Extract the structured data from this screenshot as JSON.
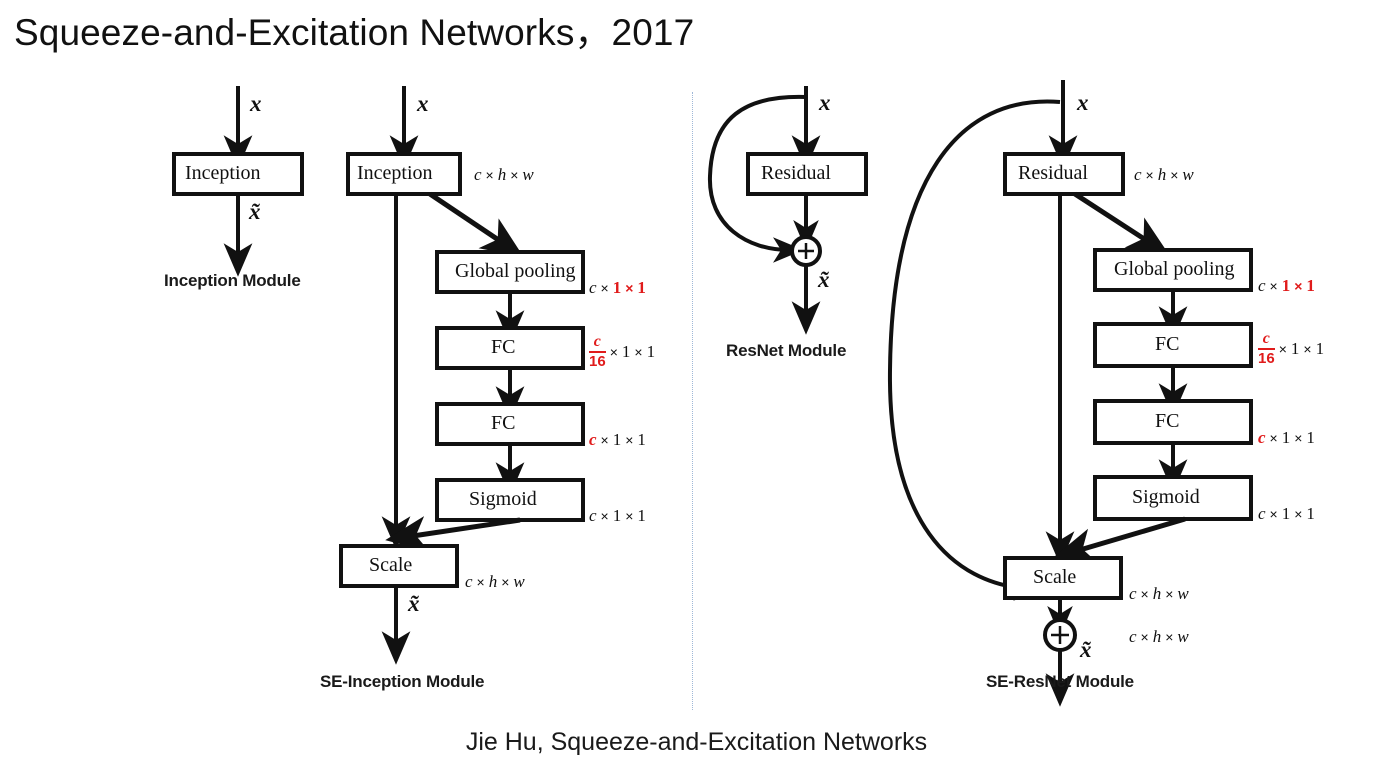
{
  "slide": {
    "title": "Squeeze-and-Excitation Networks，2017",
    "caption": "Jie Hu, Squeeze-and-Excitation Networks",
    "background": "#ffffff",
    "accent_red": "#e01b1b",
    "divider_color": "#9fb8d8"
  },
  "panels": {
    "left": {
      "inception_module": {
        "name": "Inception Module",
        "input_label": "x",
        "output_label": "x̃",
        "blocks": [
          "Inception"
        ]
      },
      "se_inception_module": {
        "name": "SE-Inception Module",
        "input_label": "x",
        "output_label": "x̃",
        "blocks": [
          "Inception",
          "Global pooling",
          "FC",
          "FC",
          "Sigmoid",
          "Scale"
        ],
        "dims": {
          "after_inception": "c × h × w",
          "after_global_pooling": "c × 1 × 1",
          "after_fc1": "c/16 × 1 × 1",
          "after_fc2": "c × 1 × 1",
          "after_sigmoid": "c × 1 × 1",
          "after_scale": "c × h × w"
        }
      }
    },
    "right": {
      "resnet_module": {
        "name": "ResNet Module",
        "input_label": "x",
        "output_label": "x̃",
        "blocks": [
          "Residual"
        ],
        "sum_symbol": "+"
      },
      "se_resnet_module": {
        "name": "SE-ResNet Module",
        "input_label": "x",
        "output_label": "x̃",
        "blocks": [
          "Residual",
          "Global pooling",
          "FC",
          "FC",
          "Sigmoid",
          "Scale"
        ],
        "sum_symbol": "+",
        "dims": {
          "after_residual": "c × h × w",
          "after_global_pooling": "c × 1 × 1",
          "after_fc1": "c/16 × 1 × 1",
          "after_fc2": "c × 1 × 1",
          "after_sigmoid": "c × 1 × 1",
          "after_scale": "c × h × w",
          "after_sum": "c × h × w"
        }
      }
    }
  },
  "labels": {
    "c": "c",
    "h": "h",
    "w": "w",
    "one": "1",
    "sixteen": "16",
    "times": "×",
    "x": "x",
    "x_tilde": "x̃",
    "plus": "+",
    "inception": "Inception",
    "residual": "Residual",
    "global_pooling": "Global pooling",
    "fc": "FC",
    "sigmoid": "Sigmoid",
    "scale": "Scale",
    "inception_module": "Inception Module",
    "se_inception_module": "SE-Inception Module",
    "resnet_module": "ResNet Module",
    "se_resnet_module": "SE-ResNet Module"
  }
}
